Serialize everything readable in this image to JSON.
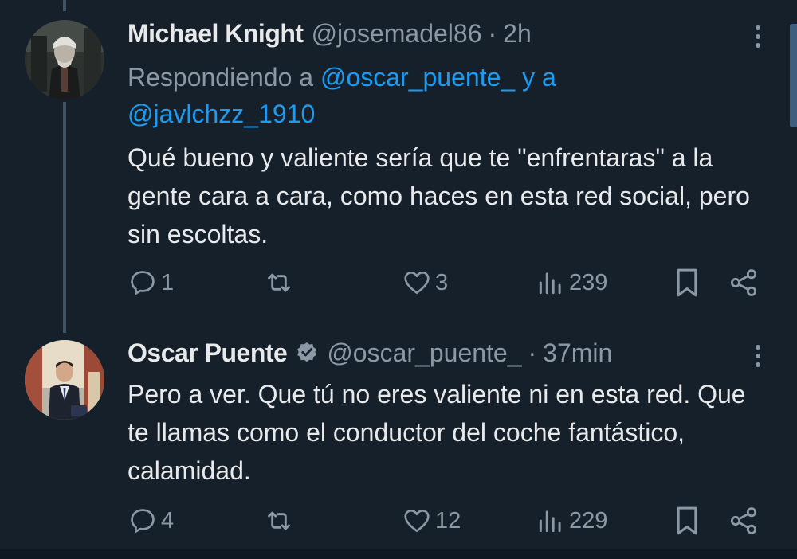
{
  "colors": {
    "background": "#15202b",
    "text_primary": "#e7e9ea",
    "text_secondary": "#8b98a5",
    "accent": "#1d9bf0",
    "thread_line": "#425364"
  },
  "tweets": [
    {
      "author_name": "Michael Knight",
      "handle": "@josemadel86",
      "separator": "·",
      "time": "2h",
      "verified": false,
      "avatar_icon": "avatar-photo-icon",
      "reply_prefix": "Respondiendo a ",
      "reply_mention_1": "@oscar_puente_",
      "reply_joiner": " y a ",
      "reply_mention_2": "@javlchzz_1910",
      "text": "Qué bueno y valiente sería que te \"enfrentaras\" a la gente cara a cara, como haces en esta red social, pero sin escoltas.",
      "replies": "1",
      "retweets": "",
      "likes": "3",
      "views": "239"
    },
    {
      "author_name": "Oscar Puente",
      "handle": "@oscar_puente_",
      "separator": "·",
      "time": "37min",
      "verified": true,
      "avatar_icon": "avatar-photo-icon",
      "text": "Pero a ver. Que tú no eres valiente ni en esta red. Que te llamas como el conductor del coche fantástico, calamidad.",
      "replies": "4",
      "retweets": "",
      "likes": "12",
      "views": "229"
    }
  ]
}
